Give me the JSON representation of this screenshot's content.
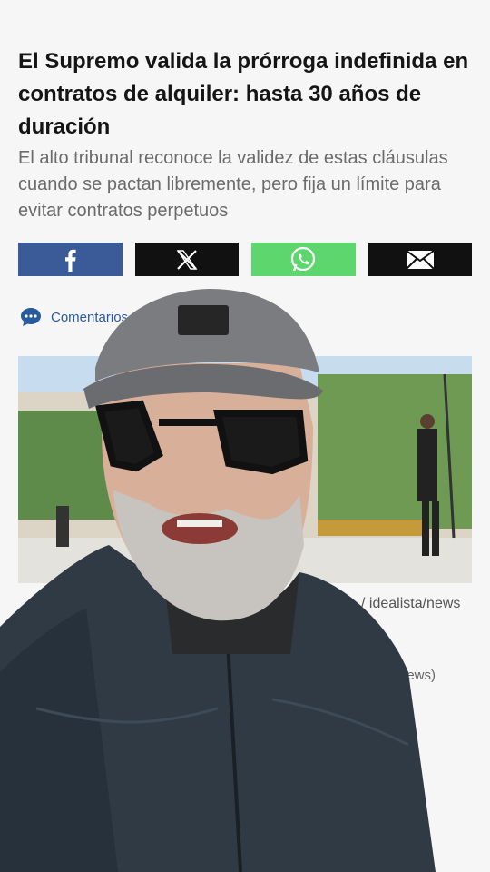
{
  "article": {
    "headline": "El Supremo valida la prórroga indefinida en contratos de alquiler: hasta 30 años de duración",
    "subhead": "El alto tribunal reconoce la validez de estas cláusulas cuando se pactan libremente, pero fija un límite para evitar contratos perpetuos",
    "comments_label": "Comentarios",
    "photo_credit": "/ idealista/news",
    "secondary_credit": "news)"
  },
  "share": {
    "buttons": [
      {
        "icon": "facebook-icon",
        "color": "#3b5a98"
      },
      {
        "icon": "x-icon",
        "color": "#111111"
      },
      {
        "icon": "whatsapp-icon",
        "color": "#5dd66d"
      },
      {
        "icon": "mail-icon",
        "color": "#111111"
      }
    ]
  },
  "colors": {
    "link": "#2a5a9e",
    "background": "#f6f6f6"
  }
}
